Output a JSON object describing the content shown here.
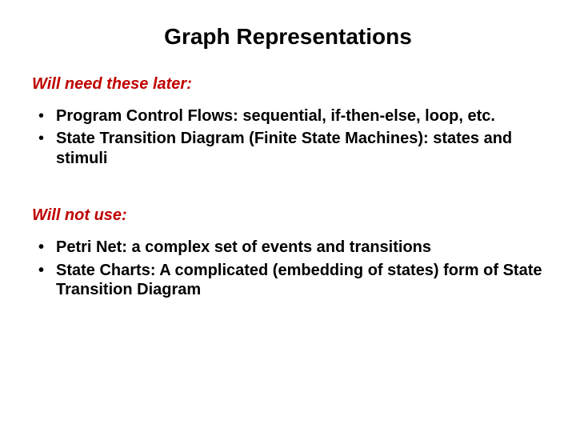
{
  "title": "Graph Representations",
  "section1": {
    "label": "Will need these later:",
    "items": [
      {
        "bold": "Program Control Flows",
        "rest": ": sequential, if-then-else, loop, etc."
      },
      {
        "bold": "State Transition Diagram ",
        "rest": "(Finite State Machines): states and stimuli"
      }
    ]
  },
  "section2": {
    "label": "Will not use:",
    "items": [
      {
        "text": "Petri Net: a complex set of events and transitions"
      },
      {
        "text": "State Charts: A complicated (embedding of states) form of State Transition Diagram"
      }
    ]
  }
}
